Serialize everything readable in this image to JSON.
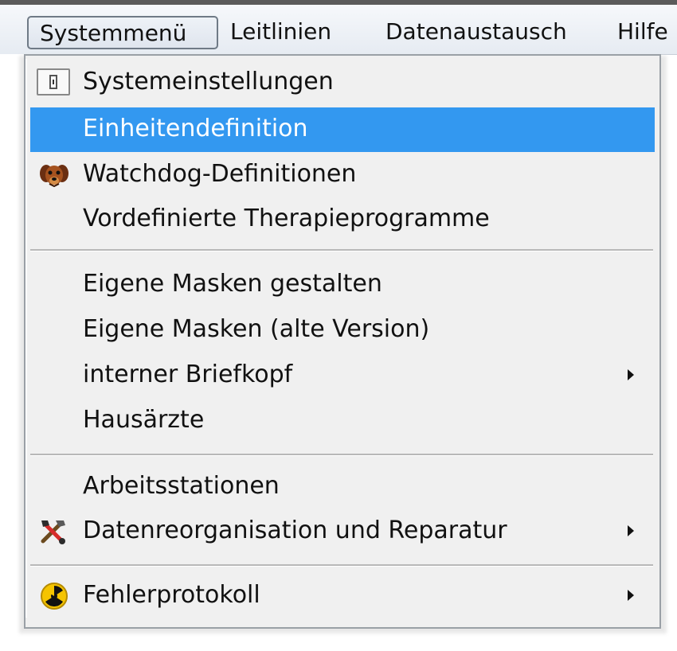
{
  "menubar": {
    "items": [
      {
        "label": "Systemmenü",
        "selected": true
      },
      {
        "label": "Leitlinien",
        "selected": false
      },
      {
        "label": "Datenaustausch",
        "selected": false
      },
      {
        "label": "Hilfe",
        "selected": false
      }
    ]
  },
  "dropdown": {
    "groups": [
      {
        "items": [
          {
            "label": "Systemeinstellungen",
            "icon": "settings-window-icon",
            "highlighted": false,
            "submenu": false
          },
          {
            "label": "Einheitendefinition",
            "icon": null,
            "highlighted": true,
            "submenu": false
          },
          {
            "label": "Watchdog-Definitionen",
            "icon": "dog-icon",
            "highlighted": false,
            "submenu": false
          },
          {
            "label": "Vordefinierte Therapieprogramme",
            "icon": null,
            "highlighted": false,
            "submenu": false
          }
        ]
      },
      {
        "items": [
          {
            "label": "Eigene Masken gestalten",
            "icon": null,
            "highlighted": false,
            "submenu": false
          },
          {
            "label": "Eigene Masken (alte Version)",
            "icon": null,
            "highlighted": false,
            "submenu": false
          },
          {
            "label": "interner Briefkopf",
            "icon": null,
            "highlighted": false,
            "submenu": true
          },
          {
            "label": "Hausärzte",
            "icon": null,
            "highlighted": false,
            "submenu": false
          }
        ]
      },
      {
        "items": [
          {
            "label": "Arbeitsstationen",
            "icon": null,
            "highlighted": false,
            "submenu": false
          },
          {
            "label": "Datenreorganisation und Reparatur",
            "icon": "tools-icon",
            "highlighted": false,
            "submenu": true
          }
        ]
      },
      {
        "items": [
          {
            "label": "Fehlerprotokoll",
            "icon": "radiation-icon",
            "highlighted": false,
            "submenu": true
          }
        ]
      }
    ]
  },
  "colors": {
    "highlight": "#3398f0",
    "menu_background": "#f0f0f0",
    "text": "#111111"
  }
}
